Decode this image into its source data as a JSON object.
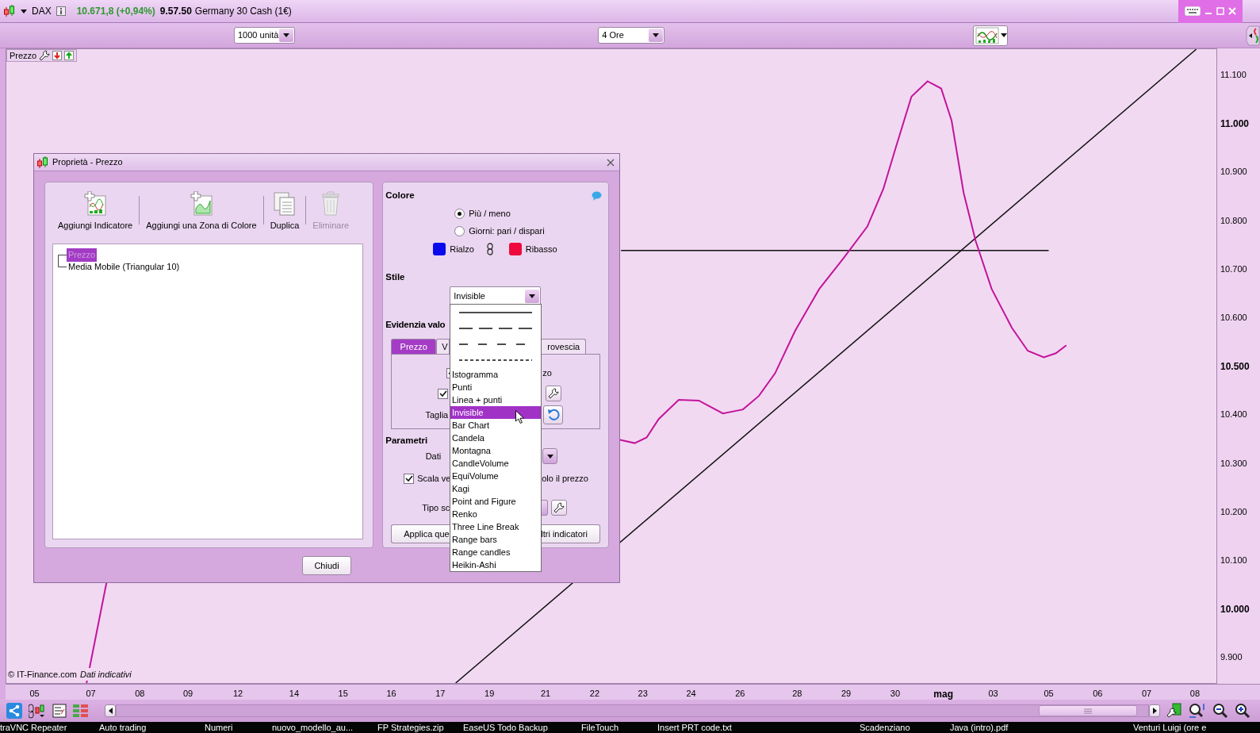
{
  "top_bar": {
    "symbol": "DAX",
    "price": "10.671,8 (+0,94%)",
    "time": "9.57.50",
    "instrument": "Germany 30 Cash (1€)"
  },
  "toolbar": {
    "quantity": "1000 unità",
    "timeframe": "4 Ore"
  },
  "chart": {
    "panel_label": "Prezzo",
    "credit": "© IT-Finance.com",
    "credit_note": "Dati indicativi",
    "price_axis": [
      {
        "label": "11.100",
        "major": false
      },
      {
        "label": "11.000",
        "major": true
      },
      {
        "label": "10.900",
        "major": false
      },
      {
        "label": "10.800",
        "major": false
      },
      {
        "label": "10.700",
        "major": false
      },
      {
        "label": "10.600",
        "major": false
      },
      {
        "label": "10.500",
        "major": true
      },
      {
        "label": "10.400",
        "major": false
      },
      {
        "label": "10.300",
        "major": false
      },
      {
        "label": "10.200",
        "major": false
      },
      {
        "label": "10.100",
        "major": false
      },
      {
        "label": "10.000",
        "major": true
      },
      {
        "label": "9.900",
        "major": false
      }
    ],
    "time_axis": [
      {
        "label": "05",
        "major": false
      },
      {
        "label": "07",
        "major": false
      },
      {
        "label": "08",
        "major": false
      },
      {
        "label": "09",
        "major": false
      },
      {
        "label": "12",
        "major": false
      },
      {
        "label": "14",
        "major": false
      },
      {
        "label": "15",
        "major": false
      },
      {
        "label": "16",
        "major": false
      },
      {
        "label": "17",
        "major": false
      },
      {
        "label": "19",
        "major": false
      },
      {
        "label": "21",
        "major": false
      },
      {
        "label": "22",
        "major": false
      },
      {
        "label": "23",
        "major": false
      },
      {
        "label": "24",
        "major": false
      },
      {
        "label": "26",
        "major": false
      },
      {
        "label": "28",
        "major": false
      },
      {
        "label": "29",
        "major": false
      },
      {
        "label": "30",
        "major": false
      },
      {
        "label": "mag",
        "major": true
      },
      {
        "label": "03",
        "major": false
      },
      {
        "label": "05",
        "major": false
      },
      {
        "label": "06",
        "major": false
      },
      {
        "label": "07",
        "major": false
      },
      {
        "label": "08",
        "major": false
      }
    ]
  },
  "dialog": {
    "title": "Proprietà - Prezzo",
    "actions": [
      {
        "label": "Aggiungi Indicatore",
        "disabled": false
      },
      {
        "label": "Aggiungi una Zona di Colore",
        "disabled": false
      },
      {
        "label": "Duplica",
        "disabled": false
      },
      {
        "label": "Eliminare",
        "disabled": true
      }
    ],
    "tree": [
      {
        "label": "Prezzo",
        "selected": true
      },
      {
        "label": "Media Mobile (Triangular 10)",
        "selected": false
      }
    ],
    "colore": {
      "title": "Colore",
      "modes": [
        {
          "label": "Più / meno",
          "selected": true
        },
        {
          "label": "Giorni: pari / dispari",
          "selected": false
        }
      ],
      "swatches": [
        {
          "label": "Rialzo",
          "color": "#0a0aee"
        },
        {
          "label": "Ribasso",
          "color": "#ee0a3c"
        }
      ]
    },
    "stile": {
      "title": "Stile",
      "value": "Invisible"
    },
    "evidenzia": {
      "title": "Evidenzia valo",
      "tabs": [
        {
          "label": "Prezzo",
          "selected": true
        },
        {
          "label": "V",
          "selected": false
        },
        {
          "label": "rovescia",
          "selected": false
        }
      ],
      "option_1": {
        "checked": true,
        "label": "zo"
      },
      "option_2": {
        "checked": true
      },
      "size_label": "Taglia"
    },
    "parametri": {
      "title": "Parametri",
      "data_label": "Dati",
      "scale": {
        "checked": true,
        "label": "Scala ve",
        "label_end": "olo il prezzo"
      },
      "type_label": "Tipo sc",
      "buttons": [
        "Applica que",
        "ltri indicatori"
      ]
    },
    "close_button": "Chiudi"
  },
  "style_menu": {
    "items": [
      {
        "kind": "solid-line",
        "selected": false
      },
      {
        "kind": "long-dash-line",
        "selected": false
      },
      {
        "kind": "dash-line",
        "selected": false
      },
      {
        "kind": "dotted-line",
        "selected": false
      },
      {
        "kind": "text",
        "label": "Istogramma",
        "selected": false
      },
      {
        "kind": "text",
        "label": "Punti",
        "selected": false
      },
      {
        "kind": "text",
        "label": "Linea + punti",
        "selected": false
      },
      {
        "kind": "text",
        "label": "Invisible",
        "selected": true
      },
      {
        "kind": "text",
        "label": "Bar Chart",
        "selected": false
      },
      {
        "kind": "text",
        "label": "Candela",
        "selected": false
      },
      {
        "kind": "text",
        "label": "Montagna",
        "selected": false
      },
      {
        "kind": "text",
        "label": "CandleVolume",
        "selected": false
      },
      {
        "kind": "text",
        "label": "EquiVolume",
        "selected": false
      },
      {
        "kind": "text",
        "label": "Kagi",
        "selected": false
      },
      {
        "kind": "text",
        "label": "Point and Figure",
        "selected": false
      },
      {
        "kind": "text",
        "label": "Renko",
        "selected": false
      },
      {
        "kind": "text",
        "label": "Three Line Break",
        "selected": false
      },
      {
        "kind": "text",
        "label": "Range bars",
        "selected": false
      },
      {
        "kind": "text",
        "label": "Range candles",
        "selected": false
      },
      {
        "kind": "text",
        "label": "Heikin-Ashi",
        "selected": false
      }
    ]
  },
  "taskbar": [
    "traVNC Repeater",
    "Auto trading",
    "Numeri",
    "nuovo_modello_au...",
    "FP Strategies.zip",
    "EaseUS Todo Backup",
    "FileTouch",
    "Insert PRT code.txt",
    "Scadenziano",
    "Java (intro).pdf",
    "Venturi Luigi (ore e"
  ]
}
